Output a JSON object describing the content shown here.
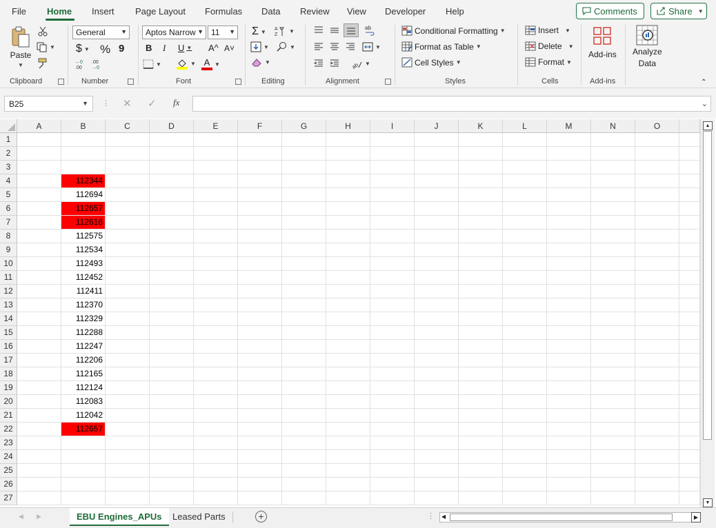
{
  "menu": {
    "items": [
      "File",
      "Home",
      "Insert",
      "Page Layout",
      "Formulas",
      "Data",
      "Review",
      "View",
      "Developer",
      "Help"
    ],
    "active": "Home",
    "comments_label": "Comments",
    "share_label": "Share"
  },
  "ribbon": {
    "clipboard": {
      "paste_label": "Paste",
      "group_label": "Clipboard"
    },
    "number": {
      "format_value": "General",
      "currency_symbol": "$",
      "percent_symbol": "%",
      "comma_symbol": "9",
      "group_label": "Number"
    },
    "font": {
      "font_name": "Aptos Narrow",
      "font_size": "11",
      "bold": "B",
      "italic": "I",
      "underline": "U",
      "grow": "A^",
      "shrink": "A˅",
      "font_color_letter": "A",
      "group_label": "Font"
    },
    "editing": {
      "group_label": "Editing"
    },
    "alignment": {
      "group_label": "Alignment"
    },
    "styles": {
      "conditional_formatting": "Conditional Formatting",
      "format_as_table": "Format as Table",
      "cell_styles": "Cell Styles",
      "group_label": "Styles"
    },
    "cells": {
      "insert": "Insert",
      "delete": "Delete",
      "format": "Format",
      "group_label": "Cells"
    },
    "addins": {
      "label": "Add-ins",
      "group_label": "Add-ins"
    },
    "analyze": {
      "line1": "Analyze",
      "line2": "Data"
    }
  },
  "formula_bar": {
    "name_box": "B25",
    "formula": "",
    "fx_label": "fx"
  },
  "grid": {
    "columns": [
      "A",
      "B",
      "C",
      "D",
      "E",
      "F",
      "G",
      "H",
      "I",
      "J",
      "K",
      "L",
      "M",
      "N",
      "O"
    ],
    "rows": [
      "1",
      "2",
      "3",
      "4",
      "5",
      "6",
      "7",
      "8",
      "9",
      "10",
      "11",
      "12",
      "13",
      "14",
      "15",
      "16",
      "17",
      "18",
      "19",
      "20",
      "21",
      "22",
      "23",
      "24",
      "25",
      "26",
      "27"
    ],
    "column_b_values": [
      {
        "row": 4,
        "value": "112344",
        "highlight": true
      },
      {
        "row": 5,
        "value": "112694",
        "highlight": false
      },
      {
        "row": 6,
        "value": "112657",
        "highlight": true
      },
      {
        "row": 7,
        "value": "112616",
        "highlight": true
      },
      {
        "row": 8,
        "value": "112575",
        "highlight": false
      },
      {
        "row": 9,
        "value": "112534",
        "highlight": false
      },
      {
        "row": 10,
        "value": "112493",
        "highlight": false
      },
      {
        "row": 11,
        "value": "112452",
        "highlight": false
      },
      {
        "row": 12,
        "value": "112411",
        "highlight": false
      },
      {
        "row": 13,
        "value": "112370",
        "highlight": false
      },
      {
        "row": 14,
        "value": "112329",
        "highlight": false
      },
      {
        "row": 15,
        "value": "112288",
        "highlight": false
      },
      {
        "row": 16,
        "value": "112247",
        "highlight": false
      },
      {
        "row": 17,
        "value": "112206",
        "highlight": false
      },
      {
        "row": 18,
        "value": "112165",
        "highlight": false
      },
      {
        "row": 19,
        "value": "112124",
        "highlight": false
      },
      {
        "row": 20,
        "value": "112083",
        "highlight": false
      },
      {
        "row": 21,
        "value": "112042",
        "highlight": false
      },
      {
        "row": 22,
        "value": "112657",
        "highlight": true
      }
    ],
    "highlight_color": "#ff0000"
  },
  "sheets": {
    "tabs": [
      "EBU Engines_APUs",
      "Leased Parts"
    ],
    "active": "EBU Engines_APUs"
  },
  "colors": {
    "accent": "#1e6b3a",
    "ribbon_bg": "#f3f3f3"
  }
}
